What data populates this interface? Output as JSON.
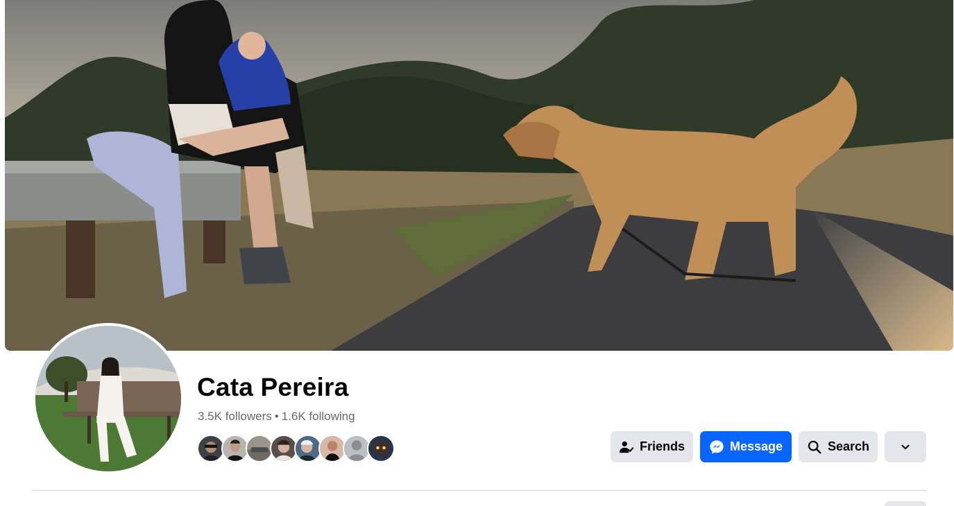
{
  "profile": {
    "name": "Cata Pereira",
    "followers": "3.5K followers",
    "separator": "•",
    "following": "1.6K following"
  },
  "cover_photo": {
    "description_icon": "cover-photo"
  },
  "mutual_friends": [
    {
      "avatar": "friend-avatar-1",
      "color": "#3d4046"
    },
    {
      "avatar": "friend-avatar-2",
      "color": "#b8b4ae"
    },
    {
      "avatar": "friend-avatar-3",
      "color": "#9a948a"
    },
    {
      "avatar": "friend-avatar-4",
      "color": "#5a4e4a"
    },
    {
      "avatar": "friend-avatar-5",
      "color": "#4d6a86"
    },
    {
      "avatar": "friend-avatar-6",
      "color": "#d6b8a6"
    },
    {
      "avatar": "friend-avatar-7",
      "color": "#bcc0c4"
    },
    {
      "avatar": "friend-avatar-8",
      "color": "#27354a"
    }
  ],
  "actions": {
    "friends_label": "Friends",
    "message_label": "Message",
    "search_label": "Search",
    "more_icon": "chevron-down-icon"
  },
  "colors": {
    "accent": "#0866ff",
    "button_bg": "#e4e6eb",
    "secondary_text": "#65676b"
  }
}
